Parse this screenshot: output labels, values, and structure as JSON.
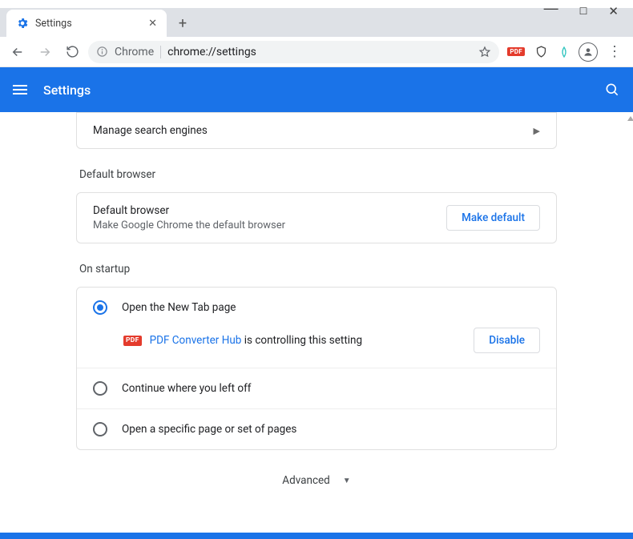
{
  "window": {
    "tab_title": "Settings",
    "url_chip": "Chrome",
    "url_path": "chrome://settings"
  },
  "header": {
    "title": "Settings"
  },
  "search_engines": {
    "manage_label": "Manage search engines"
  },
  "default_browser": {
    "section_title": "Default browser",
    "title": "Default browser",
    "subtitle": "Make Google Chrome the default browser",
    "button": "Make default"
  },
  "on_startup": {
    "section_title": "On startup",
    "options": [
      {
        "label": "Open the New Tab page",
        "checked": true
      },
      {
        "label": "Continue where you left off",
        "checked": false
      },
      {
        "label": "Open a specific page or set of pages",
        "checked": false
      }
    ],
    "controlled_by": {
      "icon": "PDF",
      "name": "PDF Converter Hub",
      "suffix": "is controlling this setting",
      "button": "Disable"
    }
  },
  "advanced_label": "Advanced"
}
